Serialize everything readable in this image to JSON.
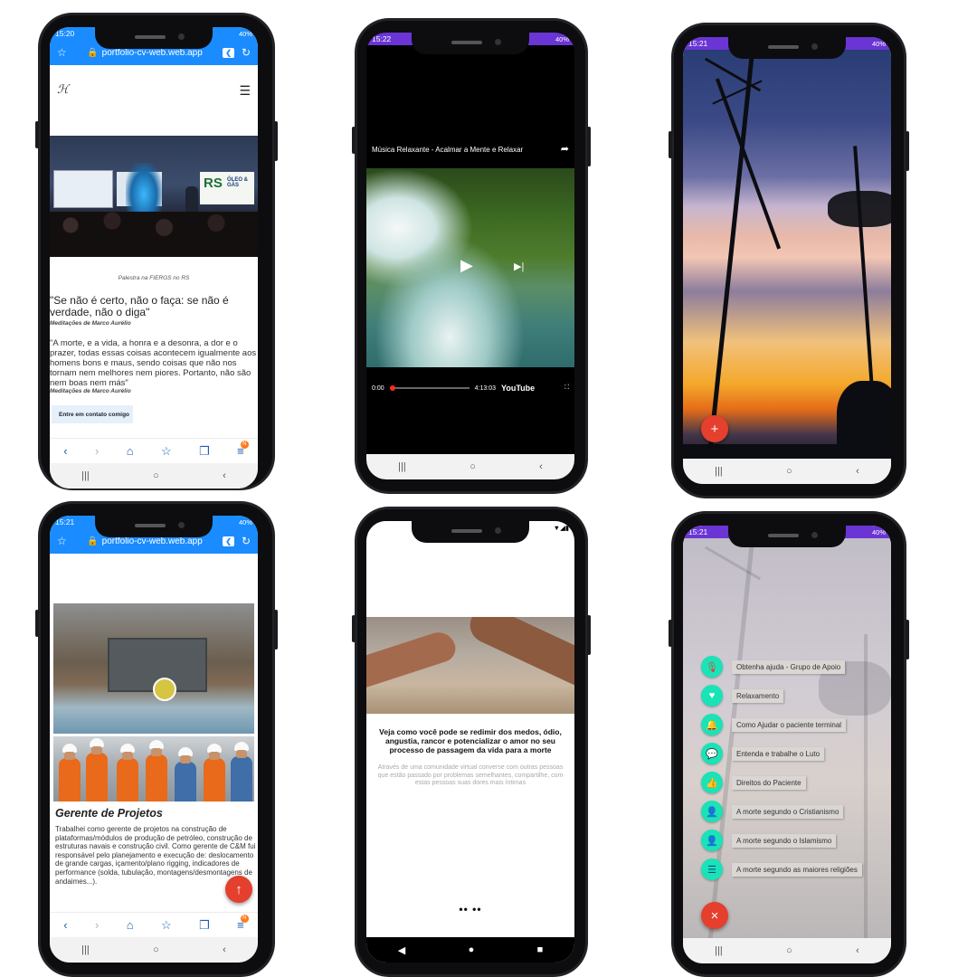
{
  "phone1": {
    "time": "15:20",
    "battery": "40%",
    "url": "portfolio-cv-web.web.app",
    "logo": "ℋ",
    "photo_caption": "Palestra na FIERGS no RS",
    "event_sign": "RS",
    "event_sign_small": "ÓLEO & GÁS",
    "quote": "\"Se não é certo, não o faça: se não é verdade, não o diga\"",
    "quote_author": "Meditações de Marco Aurélio",
    "paragraph": "\"A morte, e a vida, a honra e a desonra, a dor e o prazer, todas essas coisas acontecem igualmente aos homens bons e maus, sendo coisas que não nos tornam nem melhores nem piores. Portanto, não são nem boas nem más\"",
    "paragraph_author": "Meditações de Marco Aurélio",
    "contact_button": "Entre em contato comigo"
  },
  "phone2": {
    "time": "15:22",
    "battery": "40%",
    "video_title": "Música Relaxante - Acalmar a Mente e Relaxar",
    "time_current": "0:00",
    "time_total": "4:13:03",
    "brand": "YouTube",
    "progress": 0.0
  },
  "phone3": {
    "time": "15:21",
    "battery": "40%",
    "fab_icon": "add-icon",
    "fab_label": "+"
  },
  "phone4": {
    "time": "15:21",
    "battery": "40%",
    "url": "portfolio-cv-web.web.app",
    "job_title": "Gerente de Projetos",
    "job_description": "Trabalhei como gerente de projetos na construção de plataformas/módulos de produção de petróleo, construção de estruturas navais e construção civil. Como gerente de C&M fui responsável pelo planejamento e execução de: deslocamento de grande cargas, içamento/plano rigging, indicadores de performance (solda, tubulação, montagens/desmontagens de andaimes...).",
    "fab_icon": "arrow-up-icon"
  },
  "phone5": {
    "title": "Veja como você pode se redimir dos medos, ódio, angustia, rancor e potencializar o amor no seu processo de passagem da vida para a morte",
    "subtitle": "Através de uma comunidade virtual converse com outras pessoas que estão passado por problemas semelhantes, compartilhe, com estas pessoas suas dores mais íntimas",
    "pager": "•• ••"
  },
  "phone6": {
    "time": "15:21",
    "battery": "40%",
    "menu": [
      {
        "label": "Obtenha ajuda - Grupo de Apoio",
        "icon": "mic-icon",
        "glyph": "🎙"
      },
      {
        "label": "Relaxamento",
        "icon": "heart-pulse-icon",
        "glyph": "♥"
      },
      {
        "label": "Como Ajudar o paciente terminal",
        "icon": "bell-icon",
        "glyph": "🔔"
      },
      {
        "label": "Entenda e trabalhe o Luto",
        "icon": "chat-icon",
        "glyph": "💬"
      },
      {
        "label": "Direitos do Paciente",
        "icon": "thumbs-up-icon",
        "glyph": "👍"
      },
      {
        "label": "A morte segundo o Cristianismo",
        "icon": "person-icon",
        "glyph": "👤"
      },
      {
        "label": "A morte segundo o Islamismo",
        "icon": "person-icon",
        "glyph": "👤"
      },
      {
        "label": "A morte segundo as maiores religiões",
        "icon": "list-icon",
        "glyph": "☰"
      }
    ],
    "fab_icon": "close-icon",
    "fab_label": "×"
  },
  "colors": {
    "browser_blue": "#1a8cff",
    "status_purple": "#6a35d4",
    "fab_red": "#e53f2d",
    "menu_teal": "#19e3b7"
  }
}
